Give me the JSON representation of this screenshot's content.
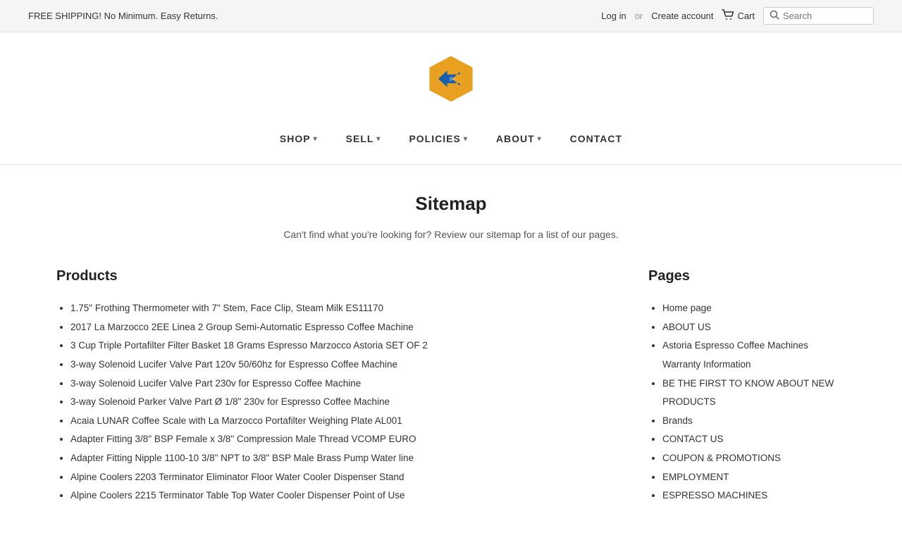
{
  "topbar": {
    "shipping_text": "FREE SHIPPING! No Minimum. Easy Returns.",
    "login_label": "Log in",
    "or_text": "or",
    "create_account_label": "Create account",
    "cart_label": "Cart",
    "search_placeholder": "Search"
  },
  "nav": {
    "items": [
      {
        "label": "SHOP",
        "has_dropdown": true
      },
      {
        "label": "SELL",
        "has_dropdown": true
      },
      {
        "label": "POLICIES",
        "has_dropdown": true
      },
      {
        "label": "ABOUT",
        "has_dropdown": true
      },
      {
        "label": "CONTACT",
        "has_dropdown": false
      }
    ]
  },
  "sitemap": {
    "title": "Sitemap",
    "description": "Can't find what you're looking for? Review our sitemap for a list of our pages.",
    "products_heading": "Products",
    "pages_heading": "Pages",
    "products": [
      "1.75\" Frothing Thermometer with 7\" Stem, Face Clip, Steam Milk ES11170",
      "2017 La Marzocco 2EE Linea 2 Group Semi-Automatic Espresso Coffee Machine",
      "3 Cup Triple Portafilter Filter Basket 18 Grams Espresso Marzocco Astoria SET OF 2",
      "3-way Solenoid Lucifer Valve Part 120v 50/60hz for Espresso Coffee Machine",
      "3-way Solenoid Lucifer Valve Part 230v for Espresso Coffee Machine",
      "3-way Solenoid Parker Valve Part Ø 1/8\" 230v for Espresso Coffee Machine",
      "Acaia LUNAR Coffee Scale with La Marzocco Portafilter Weighing Plate AL001",
      "Adapter Fitting 3/8\" BSP Female x 3/8\" Compression Male Thread VCOMP EURO",
      "Adapter Fitting Nipple 1100-10 3/8\" NPT to 3/8\" BSP Male Brass Pump Water line",
      "Alpine Coolers 2203 Terminator Eliminator Floor Water Cooler Dispenser Stand",
      "Alpine Coolers 2215 Terminator Table Top Water Cooler Dispenser Point of Use"
    ],
    "pages": [
      "Home page",
      "ABOUT US",
      "Astoria Espresso Coffee Machines Warranty Information",
      "BE THE FIRST TO KNOW ABOUT NEW PRODUCTS",
      "Brands",
      "CONTACT US",
      "COUPON & PROMOTIONS",
      "EMPLOYMENT",
      "ESPRESSO MACHINES"
    ]
  }
}
